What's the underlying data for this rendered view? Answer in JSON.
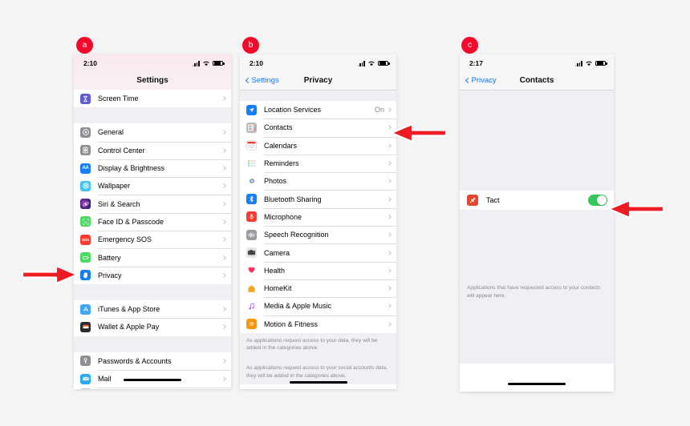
{
  "figure": {
    "panel_labels": [
      "a",
      "b",
      "c"
    ],
    "accent_red": "#f5082a",
    "arrow_color": "#ed1c24"
  },
  "panel_a": {
    "label": "a",
    "status": {
      "time": "2:10",
      "signal": "signal-bars",
      "wifi": "wifi-icon",
      "battery": "battery-icon"
    },
    "title": "Settings",
    "groups": [
      {
        "rows": [
          {
            "label": "Screen Time",
            "icon": "screen-time-icon",
            "color": "#6159d6",
            "glyph": "⌛",
            "chevron": true
          }
        ]
      },
      {
        "rows": [
          {
            "label": "General",
            "icon": "general-icon",
            "color": "#8e8e93",
            "glyph": "⚙",
            "chevron": true
          },
          {
            "label": "Control Center",
            "icon": "control-center-icon",
            "color": "#8e8e93",
            "glyph": "≡",
            "chevron": true
          },
          {
            "label": "Display & Brightness",
            "icon": "display-brightness-icon",
            "color": "#147efb",
            "glyph": "AA",
            "chevron": true
          },
          {
            "label": "Wallpaper",
            "icon": "wallpaper-icon",
            "color": "#41c4f0",
            "glyph": "❀",
            "chevron": true
          },
          {
            "label": "Siri & Search",
            "icon": "siri-search-icon",
            "color": "#2b1b4e",
            "glyph": "◎",
            "chevron": true
          },
          {
            "label": "Face ID & Passcode",
            "icon": "face-id-icon",
            "color": "#4cd964",
            "glyph": "☺",
            "chevron": true
          },
          {
            "label": "Emergency SOS",
            "icon": "emergency-sos-icon",
            "color": "#fb3b30",
            "glyph": "SOS",
            "chevron": true
          },
          {
            "label": "Battery",
            "icon": "battery-settings-icon",
            "color": "#4cd964",
            "glyph": "▭",
            "chevron": true
          },
          {
            "label": "Privacy",
            "icon": "privacy-icon",
            "color": "#147efb",
            "glyph": "✋",
            "chevron": true
          }
        ]
      },
      {
        "rows": [
          {
            "label": "iTunes & App Store",
            "icon": "app-store-icon",
            "color": "#41a5f5",
            "glyph": "A",
            "chevron": true
          },
          {
            "label": "Wallet & Apple Pay",
            "icon": "wallet-icon",
            "color": "#2c2c2e",
            "glyph": "▤",
            "chevron": true
          }
        ]
      },
      {
        "rows": [
          {
            "label": "Passwords & Accounts",
            "icon": "passwords-icon",
            "color": "#8e8e93",
            "glyph": "⚿",
            "chevron": true
          },
          {
            "label": "Mail",
            "icon": "mail-icon",
            "color": "#2fa9ee",
            "glyph": "✉",
            "chevron": true
          }
        ]
      }
    ],
    "arrow": {
      "name": "arrow-pointing-to-privacy",
      "direction": "right"
    }
  },
  "panel_b": {
    "label": "b",
    "status": {
      "time": "2:10",
      "signal": "signal-bars",
      "wifi": "wifi-icon",
      "battery": "battery-icon"
    },
    "back_label": "Settings",
    "title": "Privacy",
    "rows": [
      {
        "label": "Location Services",
        "icon": "location-services-icon",
        "color": "#147efb",
        "glyph": "➤",
        "value": "On",
        "chevron": true
      },
      {
        "label": "Contacts",
        "icon": "contacts-icon",
        "color": "#b9b9be",
        "glyph": "☷",
        "chevron": true
      },
      {
        "label": "Calendars",
        "icon": "calendars-icon",
        "color": "#ffffff",
        "glyph": "▤",
        "chevron": true
      },
      {
        "label": "Reminders",
        "icon": "reminders-icon",
        "color": "#ffffff",
        "glyph": "☰",
        "chevron": true
      },
      {
        "label": "Photos",
        "icon": "photos-icon",
        "color": "#ffffff",
        "glyph": "✿",
        "chevron": true
      },
      {
        "label": "Bluetooth Sharing",
        "icon": "bluetooth-sharing-icon",
        "color": "#147efb",
        "glyph": "ᛗ",
        "chevron": true
      },
      {
        "label": "Microphone",
        "icon": "microphone-icon",
        "color": "#fb3b30",
        "glyph": "Ἲ4",
        "chevron": true
      },
      {
        "label": "Speech Recognition",
        "icon": "speech-recognition-icon",
        "color": "#9a9aa0",
        "glyph": "≈",
        "chevron": true
      },
      {
        "label": "Camera",
        "icon": "camera-icon",
        "color": "#5a5a5e",
        "glyph": "◉",
        "chevron": true
      },
      {
        "label": "Health",
        "icon": "health-icon",
        "color": "#ffffff",
        "glyph": "♥",
        "chevron": true
      },
      {
        "label": "HomeKit",
        "icon": "homekit-icon",
        "color": "#ffffff",
        "glyph": "⌂",
        "chevron": true
      },
      {
        "label": "Media & Apple Music",
        "icon": "media-apple-music-icon",
        "color": "#ffffff",
        "glyph": "♫",
        "chevron": true
      },
      {
        "label": "Motion & Fitness",
        "icon": "motion-fitness-icon",
        "color": "#ff9500",
        "glyph": "≡",
        "chevron": true
      }
    ],
    "footer_1": "As applications request access to your data, they will be added in the categories above.",
    "footer_2": "As applications request access to your social accounts data, they will be added in the categories above.",
    "arrow": {
      "name": "arrow-pointing-to-contacts",
      "direction": "left"
    }
  },
  "panel_c": {
    "label": "c",
    "status": {
      "time": "2:17",
      "signal": "signal-bars",
      "wifi": "wifi-icon",
      "battery": "battery-icon"
    },
    "back_label": "Privacy",
    "title": "Contacts",
    "app_row": {
      "label": "Tact",
      "icon": "tact-app-icon",
      "color": "#e8452c",
      "glyph": "📌",
      "toggle_on": true,
      "toggle_color": "#34c759"
    },
    "footer": "Applications that have requested access to your contacts will appear here.",
    "arrow": {
      "name": "arrow-pointing-to-tact-toggle",
      "direction": "left"
    }
  }
}
